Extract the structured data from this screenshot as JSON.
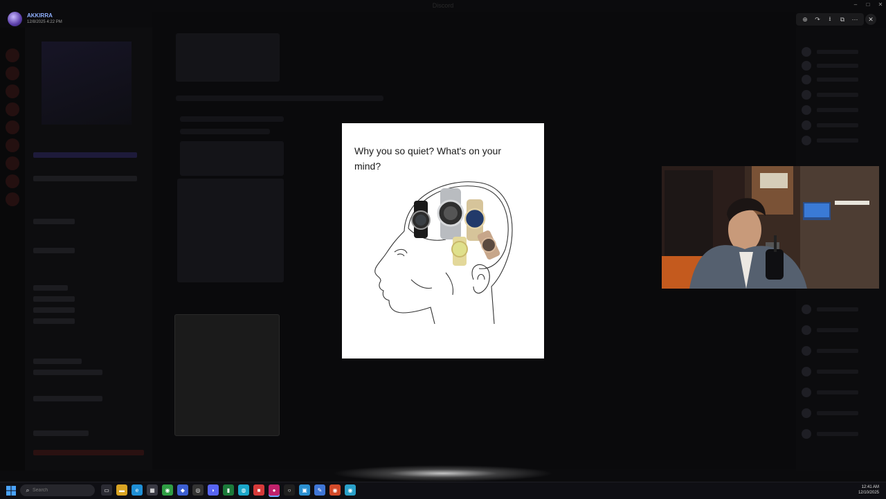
{
  "app": {
    "window_title": "Discord"
  },
  "uploader": {
    "name": "AKKIRRA",
    "date": "12/8/2025 4:22 PM"
  },
  "viewer": {
    "toolbar": [
      "zoom-in-icon",
      "forward-icon",
      "download-icon",
      "open-external-icon",
      "more-icon"
    ],
    "toolbar_glyphs": [
      "⊕",
      "↷",
      "⭳",
      "⧉",
      "⋯"
    ],
    "close_glyph": "✕"
  },
  "meme": {
    "caption": "Why you so quiet? What's on your mind?"
  },
  "window_controls": {
    "minimize": "–",
    "maximize": "□",
    "close": "✕"
  },
  "taskbar": {
    "search_placeholder": "Search",
    "search_icon": "⌕",
    "apps": [
      {
        "name": "task-view-icon",
        "glyph": "▭",
        "color": "#2b2b33"
      },
      {
        "name": "file-explorer-icon",
        "glyph": "▬",
        "color": "#d9a423"
      },
      {
        "name": "edge-icon",
        "glyph": "e",
        "color": "#1f8fd6"
      },
      {
        "name": "store-icon",
        "glyph": "▦",
        "color": "#3a3a44"
      },
      {
        "name": "chrome-icon",
        "glyph": "◉",
        "color": "#2f9e44"
      },
      {
        "name": "app-icon",
        "glyph": "◆",
        "color": "#3c5fd1"
      },
      {
        "name": "obs-icon",
        "glyph": "◎",
        "color": "#333"
      },
      {
        "name": "discord-icon",
        "glyph": "◗",
        "color": "#5865f2"
      },
      {
        "name": "stats-icon",
        "glyph": "▮",
        "color": "#1b7a3a"
      },
      {
        "name": "browser-icon",
        "glyph": "◍",
        "color": "#1aa6c9"
      },
      {
        "name": "roblox-icon",
        "glyph": "■",
        "color": "#d63a3a"
      },
      {
        "name": "recording-icon",
        "glyph": "●",
        "color": "#c0216b"
      },
      {
        "name": "capture-icon",
        "glyph": "○",
        "color": "#1f1f1f"
      },
      {
        "name": "photos-icon",
        "glyph": "▣",
        "color": "#2a8fd0"
      },
      {
        "name": "editor-icon",
        "glyph": "✎",
        "color": "#3f76d6"
      },
      {
        "name": "chrome-profile-icon",
        "glyph": "◉",
        "color": "#d34a2a"
      },
      {
        "name": "chrome-dev-icon",
        "glyph": "◉",
        "color": "#2aa0c9"
      }
    ],
    "time": "12:41 AM",
    "date": "12/10/2025"
  }
}
